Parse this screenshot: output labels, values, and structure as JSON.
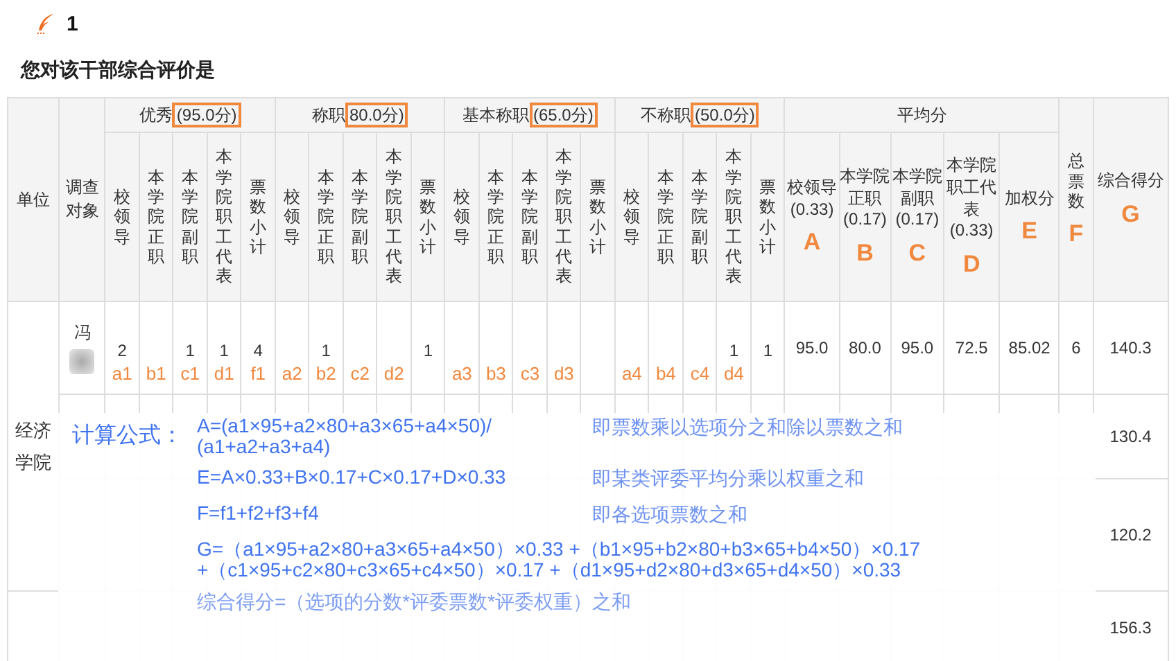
{
  "question": {
    "number": "1",
    "title": "您对该干部综合评价是"
  },
  "table": {
    "unit_header": "单位",
    "subject_header": "调查对象",
    "groups": [
      {
        "name": "优秀",
        "score": "(95.0分)",
        "columns": [
          "校领导",
          "本学院正职",
          "本学院副职",
          "本学院职工代表",
          "票数小计"
        ]
      },
      {
        "name": "称职",
        "score": "80.0分)",
        "columns": [
          "校领导",
          "本学院正职",
          "本学院副职",
          "本学院职工代表",
          "票数小计"
        ]
      },
      {
        "name": "基本称职",
        "score": "(65.0分)",
        "columns": [
          "校领导",
          "本学院正职",
          "本学院副职",
          "本学院职工代表",
          "票数小计"
        ]
      },
      {
        "name": "不称职",
        "score": "(50.0分)",
        "columns": [
          "校领导",
          "本学院正职",
          "本学院副职",
          "本学院职工代表",
          "票数小计"
        ]
      }
    ],
    "average": {
      "name": "平均分",
      "columns": [
        {
          "label": "校领导",
          "weight": "(0.33)",
          "letter": "A"
        },
        {
          "label": "本学院正职",
          "weight": "(0.17)",
          "letter": "B"
        },
        {
          "label": "本学院副职",
          "weight": "(0.17)",
          "letter": "C"
        },
        {
          "label": "本学院职工代表",
          "weight": "(0.33)",
          "letter": "D"
        },
        {
          "label": "加权分",
          "letter": "E"
        }
      ]
    },
    "total_votes": {
      "label": "总票数",
      "letter": "F"
    },
    "composite": {
      "label": "综合得分",
      "letter": "G"
    },
    "unit": "经济学院",
    "rows": [
      {
        "subject": "冯",
        "redacted": true,
        "cells": [
          {
            "value": "2",
            "tag": "a1"
          },
          {
            "tag": "b1"
          },
          {
            "value": "1",
            "tag": "c1"
          },
          {
            "value": "1",
            "tag": "d1"
          },
          {
            "value": "4",
            "tag": "f1"
          },
          {
            "tag": "a2"
          },
          {
            "value": "1",
            "tag": "b2"
          },
          {
            "tag": "c2"
          },
          {
            "tag": "d2"
          },
          {
            "value": "1"
          },
          {
            "tag": "a3"
          },
          {
            "tag": "b3"
          },
          {
            "tag": "c3"
          },
          {
            "tag": "d3"
          },
          {},
          {
            "tag": "a4"
          },
          {
            "tag": "b4"
          },
          {
            "tag": "c4"
          },
          {
            "value": "1",
            "tag": "d4"
          },
          {
            "value": "1"
          }
        ],
        "averages": [
          "95.0",
          "80.0",
          "95.0",
          "72.5",
          "85.02"
        ],
        "total": "6",
        "score": "140.3"
      },
      {
        "score": "130.4"
      },
      {
        "score": "120.2"
      },
      {
        "score": "156.3"
      }
    ]
  },
  "formula": {
    "title": "计算公式：",
    "items": [
      {
        "kind": "formula",
        "lines": [
          "A=(a1×95+a2×80+a3×65+a4×50)/",
          "(a1+a2+a3+a4)"
        ],
        "note": "即票数乘以选项分之和除以票数之和"
      },
      {
        "kind": "formula",
        "lines": [
          "E=A×0.33+B×0.17+C×0.17+D×0.33"
        ],
        "note": "即某类评委平均分乘以权重之和"
      },
      {
        "kind": "formula",
        "lines": [
          "F=f1+f2+f3+f4"
        ],
        "note": "即各选项票数之和"
      },
      {
        "kind": "formula",
        "lines": [
          "G=（a1×95+a2×80+a3×65+a4×50）×0.33 +（b1×95+b2×80+b3×65+b4×50）×0.17",
          "+（c1×95+c2×80+c3×65+c4×50）×0.17 +（d1×95+d2×80+d3×65+d4×50）×0.33"
        ]
      },
      {
        "kind": "summary",
        "lines": [
          "综合得分=（选项的分数*评委票数*评委权重）之和"
        ]
      }
    ]
  }
}
